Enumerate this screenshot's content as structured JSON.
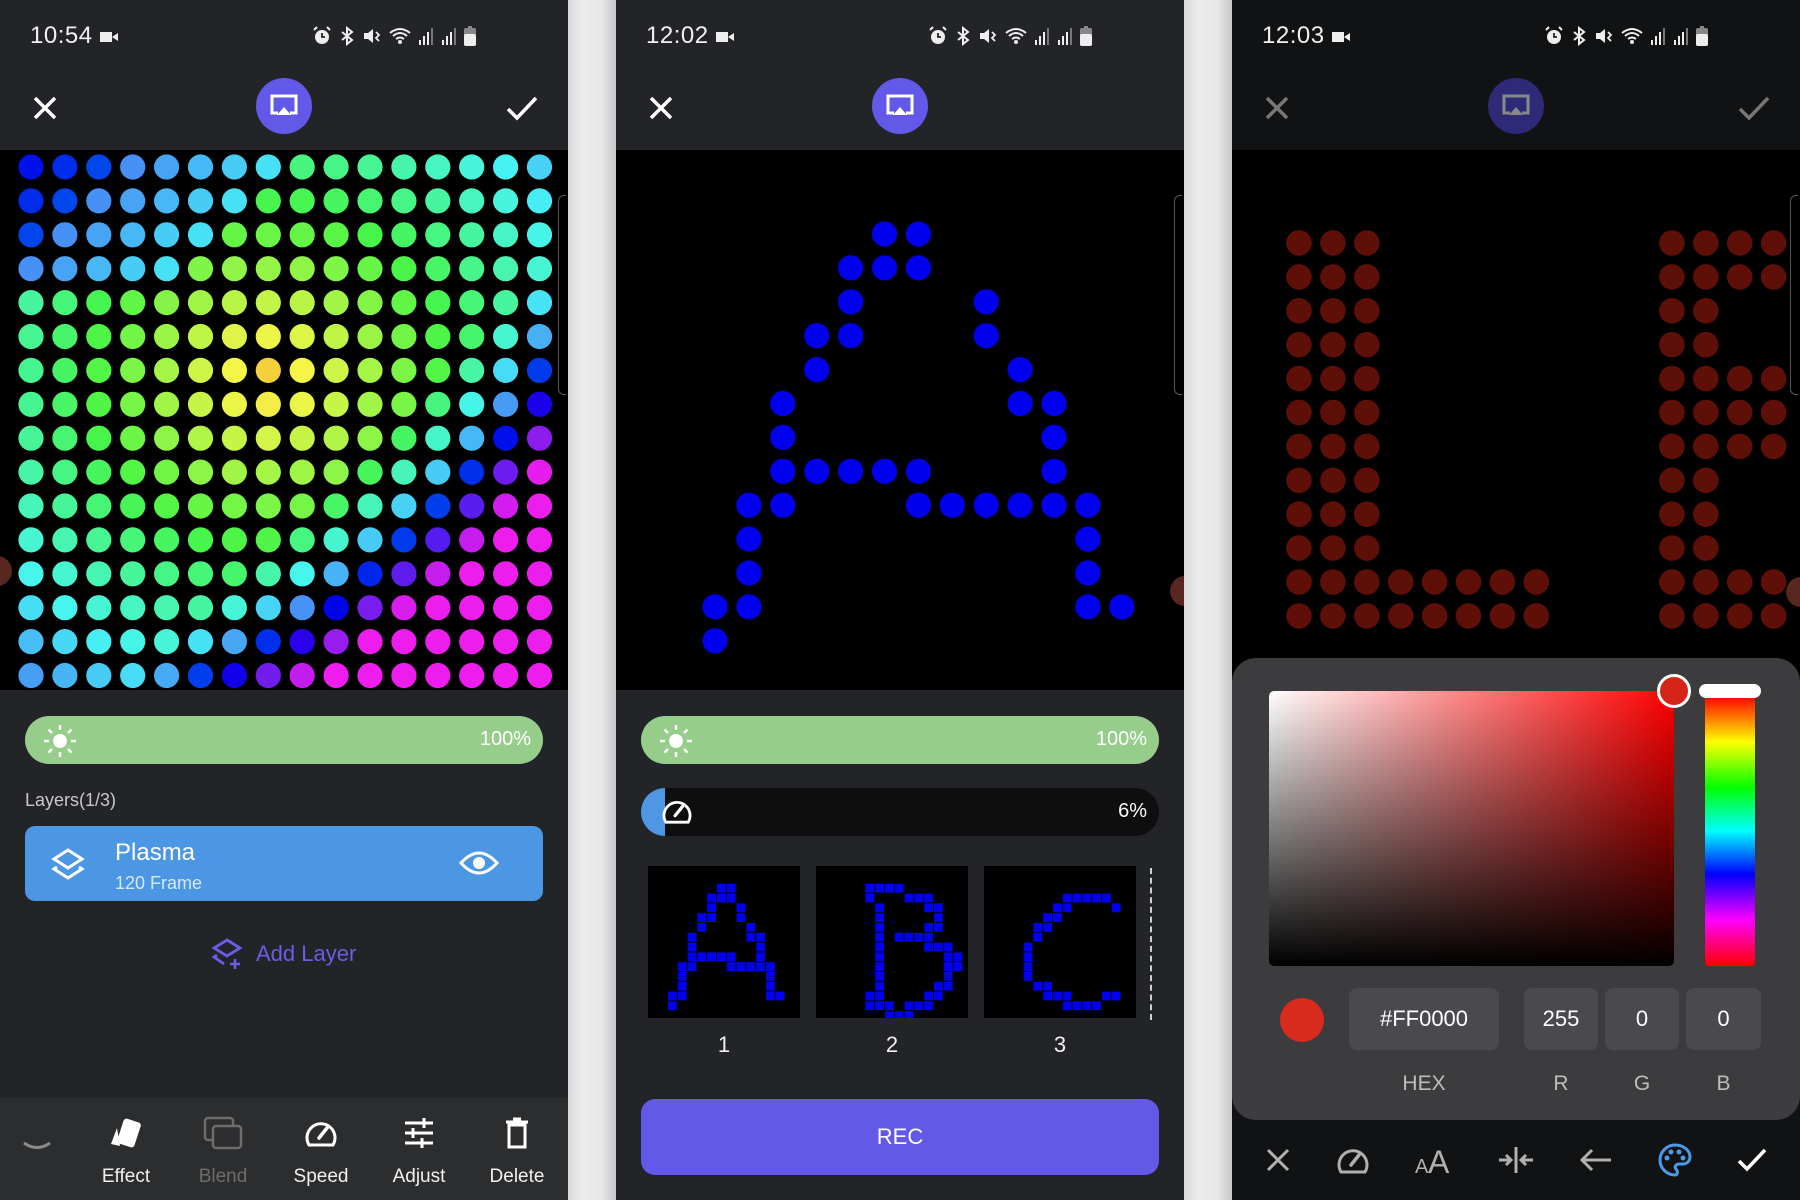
{
  "screens": [
    {
      "status": {
        "time": "10:54"
      },
      "topbar": {
        "close_icon": "close-icon",
        "cast_icon": "cast-icon",
        "confirm_icon": "check-icon"
      },
      "matrix": {
        "type": "plasma-effect",
        "cols": 16,
        "rows": 16
      },
      "brightness": {
        "value_label": "100%",
        "value": 100,
        "icon": "sun-icon"
      },
      "layers": {
        "label": "Layers(1/3)",
        "current": 1,
        "total": 3,
        "items": [
          {
            "name": "Plasma",
            "frames": "120 Frame",
            "visible": true
          }
        ],
        "add_label": "Add Layer"
      },
      "bottom_bar": [
        {
          "label": "Effect",
          "icon": "effect-cards-icon",
          "enabled": true
        },
        {
          "label": "Blend",
          "icon": "blend-icon",
          "enabled": false
        },
        {
          "label": "Speed",
          "icon": "speedometer-icon",
          "enabled": true
        },
        {
          "label": "Adjust",
          "icon": "sliders-icon",
          "enabled": true
        },
        {
          "label": "Delete",
          "icon": "trash-icon",
          "enabled": true
        }
      ]
    },
    {
      "status": {
        "time": "12:02"
      },
      "matrix": {
        "type": "text-frame",
        "letter": "A",
        "dot_color": "#0000ee"
      },
      "brightness": {
        "value_label": "100%",
        "value": 100
      },
      "speed": {
        "value_label": "6%",
        "value": 6
      },
      "frames": [
        {
          "num": "1",
          "letter": "A"
        },
        {
          "num": "2",
          "letter": "B"
        },
        {
          "num": "3",
          "letter": "C"
        }
      ],
      "rec_label": "REC"
    },
    {
      "status": {
        "time": "12:03"
      },
      "matrix": {
        "type": "scrolling-text",
        "letters": "LE",
        "dot_color": "#5e0f08"
      },
      "color_picker": {
        "hex": "#FF0000",
        "r": "255",
        "g": "0",
        "b": "0",
        "labels": {
          "hex": "HEX",
          "r": "R",
          "g": "G",
          "b": "B"
        },
        "swatch_color": "#d82a1e"
      },
      "tool_bar": [
        {
          "icon": "close-icon",
          "active": false
        },
        {
          "icon": "speedometer-icon",
          "active": false
        },
        {
          "icon": "font-size-icon",
          "active": false
        },
        {
          "icon": "spacing-icon",
          "active": false
        },
        {
          "icon": "arrow-left-icon",
          "active": false
        },
        {
          "icon": "palette-icon",
          "active": true
        },
        {
          "icon": "check-icon",
          "active": false
        }
      ]
    }
  ],
  "colors": {
    "accent": "#6359e8",
    "brightness": "#97cd8b",
    "layer_card": "#4c97e3",
    "speed_fill": "#4f97e5"
  }
}
